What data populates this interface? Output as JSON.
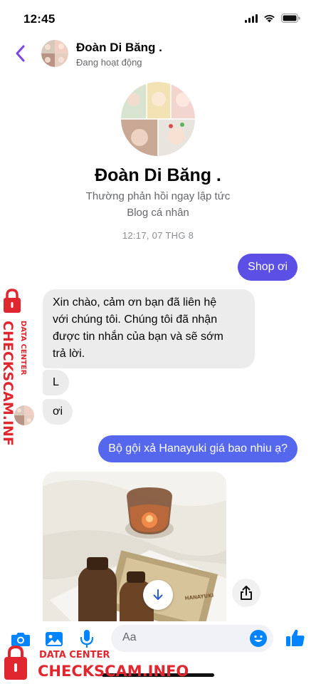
{
  "status_bar": {
    "time": "12:45"
  },
  "header": {
    "contact_name": "Đoàn Di Băng .",
    "activity_status": "Đang hoạt động"
  },
  "profile": {
    "name": "Đoàn Di Băng .",
    "response_note": "Thường phản hồi ngay lập tức",
    "page_type": "Blog cá nhân"
  },
  "conversation": {
    "timestamp": "12:17, 07 THG 8",
    "messages": [
      {
        "direction": "outgoing",
        "text": "Shop ơi"
      },
      {
        "direction": "incoming",
        "lines": [
          "Xin chào, cảm ơn bạn đã liên hệ",
          "với chúng tôi. Chúng tôi đã nhận",
          "được tin nhắn của bạn và sẽ sớm",
          "trả lời."
        ]
      },
      {
        "direction": "incoming",
        "text": "L"
      },
      {
        "direction": "incoming",
        "text": "ơi"
      },
      {
        "direction": "outgoing",
        "text": "Bộ gội xả Hanayuki giá bao nhiu ạ?"
      }
    ]
  },
  "photo_attachment": {
    "product_label": "HANAYUKI"
  },
  "composer": {
    "placeholder": "Aa"
  },
  "watermark": {
    "vertical_top": "DATA CENTER",
    "vertical_main": "CHECKSCAM.INFO",
    "bottom_top": "DATA CENTER",
    "bottom_main": "CHECKSCAM.INFO"
  },
  "colors": {
    "accent": "#5b4fe6",
    "messenger_blue": "#0084ff",
    "incoming_bubble": "#ececec",
    "watermark_red": "#e0272f"
  }
}
